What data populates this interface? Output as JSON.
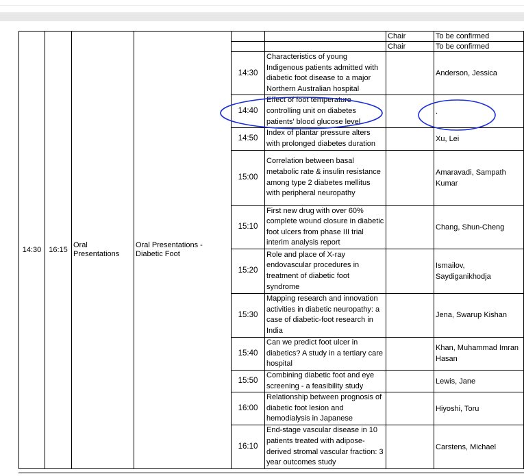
{
  "session": {
    "start": "14:30",
    "end": "16:15",
    "type": "Oral Presentations",
    "title": "Oral Presentations - Diabetic Foot"
  },
  "chairs": [
    {
      "role": "Chair",
      "name": "To be confirmed"
    },
    {
      "role": "Chair",
      "name": "To be confirmed"
    }
  ],
  "talks": [
    {
      "time": "14:30",
      "title": "Characteristics of young Indigenous patients admitted with diabetic foot disease to a major Northern Australian hospital",
      "presenter": "Anderson, Jessica"
    },
    {
      "time": "14:40",
      "title": "Effect of foot temperature controlling unit on diabetes patients' blood glucose level",
      "presenter": "."
    },
    {
      "time": "14:50",
      "title": "Index of plantar pressure alters with prolonged diabetes duration",
      "presenter": "Xu, Lei"
    },
    {
      "time": "15:00",
      "title": "Correlation between basal metabolic rate & insulin resistance among type 2 diabetes mellitus with peripheral neuropathy",
      "presenter": "Amaravadi, Sampath Kumar"
    },
    {
      "time": "15:10",
      "title": "First new drug with over 60% complete wound closure in diabetic foot ulcers from phase III trial interim analysis report",
      "presenter": "Chang, Shun-Cheng"
    },
    {
      "time": "15:20",
      "title": "Role and place of X-ray endovascular procedures in treatment of diabetic foot syndrome",
      "presenter": "Ismailov, Saydiganikhodja"
    },
    {
      "time": "15:30",
      "title": "Mapping research and innovation activities in diabetic neuropathy: a case of diabetic-foot research in India",
      "presenter": "Jena, Swarup Kishan"
    },
    {
      "time": "15:40",
      "title": "Can we predict foot ulcer in diabetics? A study in a tertiary care hospital",
      "presenter": "Khan, Muhammad Imran Hasan"
    },
    {
      "time": "15:50",
      "title": "Combining diabetic foot and eye screening - a feasibility study",
      "presenter": "Lewis, Jane"
    },
    {
      "time": "16:00",
      "title": "Relationship between prognosis of diabetic foot lesion and hemodialysis in Japanese",
      "presenter": "Hiyoshi, Toru"
    },
    {
      "time": "16:10",
      "title": "End-stage vascular disease in 10 patients treated with adipose-derived stromal vascular fraction: 3 year outcomes study",
      "presenter": "Carstens, Michael"
    }
  ],
  "annotation_color": "#1a2fd6"
}
